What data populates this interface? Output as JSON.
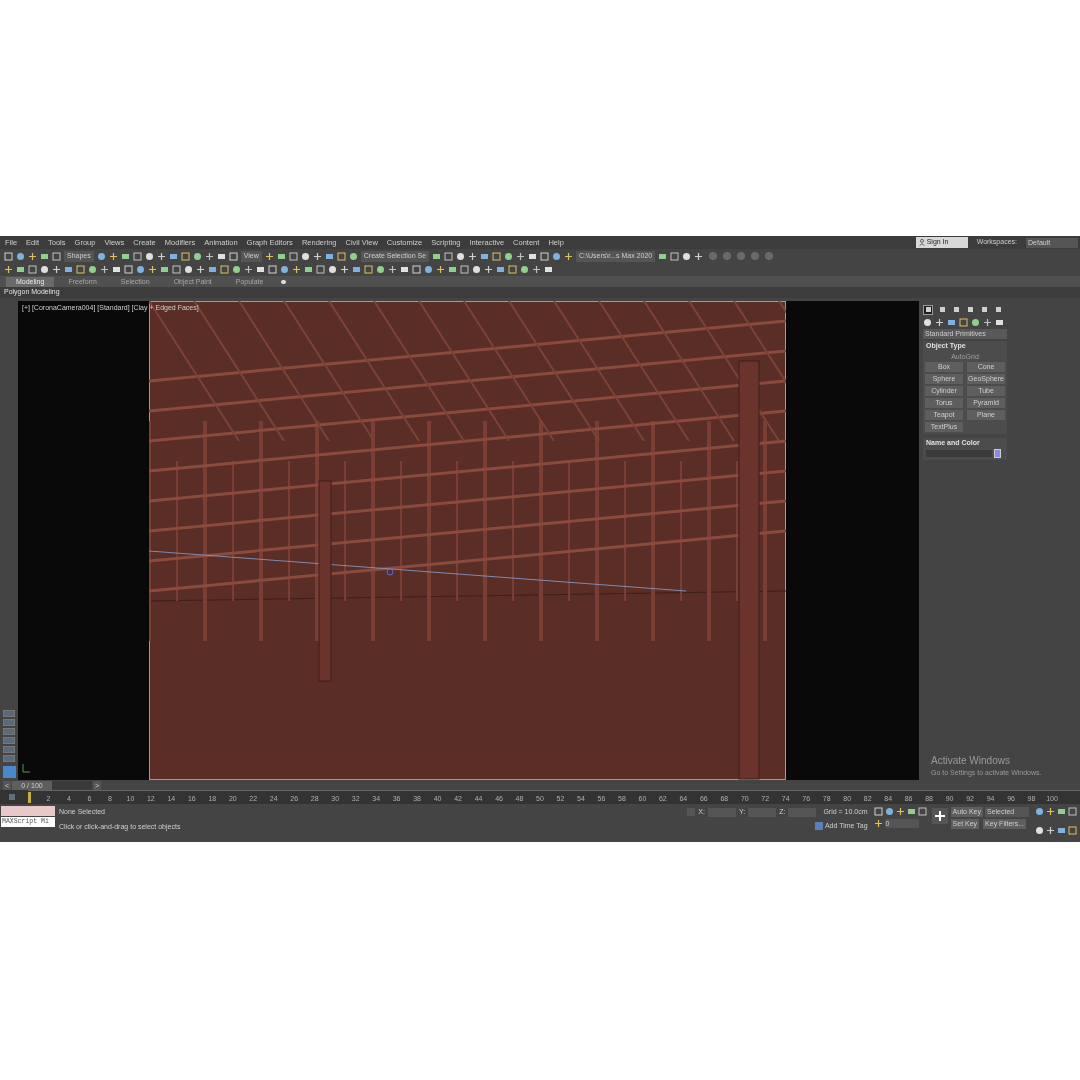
{
  "menu": [
    "File",
    "Edit",
    "Tools",
    "Group",
    "Views",
    "Create",
    "Modifiers",
    "Animation",
    "Graph Editors",
    "Rendering",
    "Civil View",
    "Customize",
    "Scripting",
    "Interactive",
    "Content",
    "Help"
  ],
  "account": {
    "sign_in": "Sign In",
    "workspaces_label": "Workspaces:",
    "workspace": "Default"
  },
  "toolbar": {
    "dropdowns": [
      "Shapes",
      "View",
      "Create Selection Se",
      "C:\\Users\\r...s Max 2020"
    ]
  },
  "ribbon": {
    "tabs": [
      {
        "label": "Modeling",
        "selected": true
      },
      {
        "label": "Freeform",
        "selected": false
      },
      {
        "label": "Selection",
        "selected": false
      },
      {
        "label": "Object Paint",
        "selected": false
      },
      {
        "label": "Populate",
        "selected": false
      }
    ],
    "panel": "Polygon Modeling"
  },
  "viewport": {
    "label": "[+] [CoronaCamera004] [Standard] [Clay + Edged Faces]"
  },
  "command_panel": {
    "tabs": [
      {
        "selected": true
      },
      {
        "selected": false
      },
      {
        "selected": false
      },
      {
        "selected": false
      },
      {
        "selected": false
      },
      {
        "selected": false
      }
    ],
    "category": "Standard Primitives",
    "object_type": {
      "title": "Object Type",
      "autogrid": {
        "label": "AutoGrid",
        "disabled": true
      },
      "buttons": [
        "Box",
        "Cone",
        "Sphere",
        "GeoSphere",
        "Cylinder",
        "Tube",
        "Torus",
        "Pyramid",
        "Teapot",
        "Plane",
        "TextPlus"
      ]
    },
    "name_and_color": {
      "title": "Name and Color",
      "color": "#8a8ae6"
    }
  },
  "timeline": {
    "prev": "<",
    "slider": "0 / 100",
    "level": 0,
    "next": ">",
    "ruler_labels": [
      "2",
      "4",
      "6",
      "8",
      "10",
      "12",
      "14",
      "16",
      "18",
      "20",
      "22",
      "24",
      "26",
      "28",
      "30",
      "32",
      "34",
      "36",
      "38",
      "40",
      "42",
      "44",
      "46",
      "48",
      "50",
      "52",
      "54",
      "56",
      "58",
      "60",
      "62",
      "64",
      "66",
      "68",
      "70",
      "72",
      "74",
      "76",
      "78",
      "80",
      "82",
      "84",
      "86",
      "88",
      "90",
      "92",
      "94",
      "96",
      "98",
      "100"
    ]
  },
  "status": {
    "listener": "MAXScript Mi",
    "selection": "None Selected",
    "prompt": "Click or click-and-drag to select objects",
    "coords": [
      "X:",
      "Y:",
      "Z:"
    ],
    "grid": "Grid = 10.0cm",
    "time_tag": "Add Time Tag",
    "auto_key": "Auto Key",
    "key_mode": "Selected",
    "set_key": "Set Key",
    "key_filters": "Key Filters...",
    "frame": "0"
  },
  "activation": {
    "title": "Activate Windows",
    "message": "Go to Settings to activate Windows."
  }
}
